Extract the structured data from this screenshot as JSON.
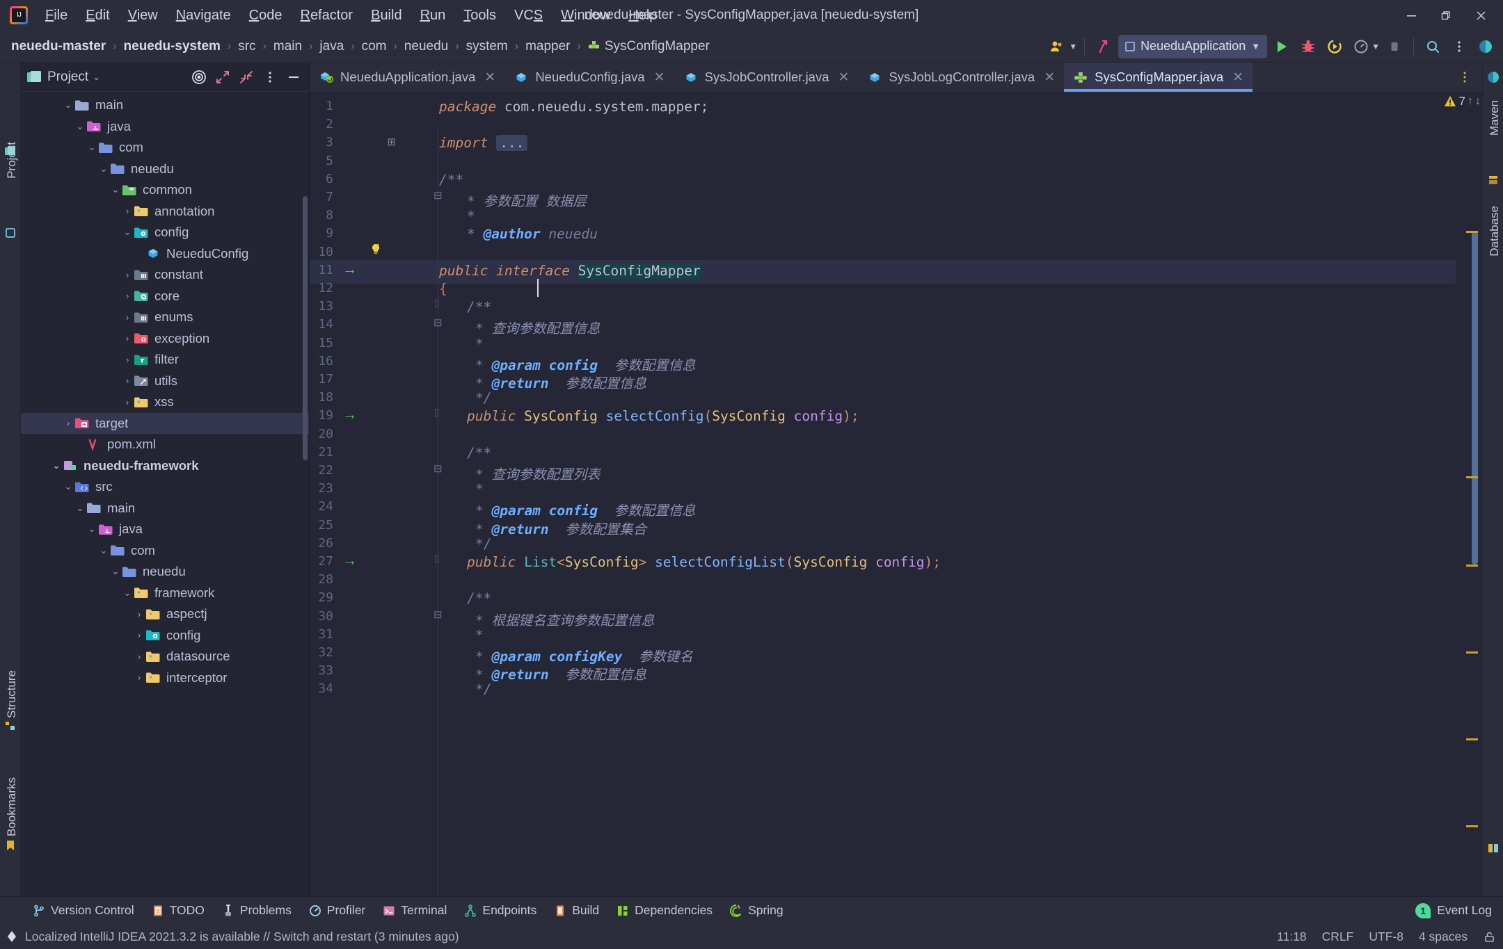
{
  "window": {
    "title": "neuedu-master - SysConfigMapper.java [neuedu-system]",
    "minimize": "–",
    "restore": "❐",
    "close": "✕"
  },
  "menubar": {
    "items": [
      {
        "label": "File",
        "mnemonic": "F"
      },
      {
        "label": "Edit",
        "mnemonic": "E"
      },
      {
        "label": "View",
        "mnemonic": "V"
      },
      {
        "label": "Navigate",
        "mnemonic": "N"
      },
      {
        "label": "Code",
        "mnemonic": "C"
      },
      {
        "label": "Refactor",
        "mnemonic": "R"
      },
      {
        "label": "Build",
        "mnemonic": "B"
      },
      {
        "label": "Run",
        "mnemonic": "R"
      },
      {
        "label": "Tools",
        "mnemonic": "T"
      },
      {
        "label": "VCS",
        "mnemonic": "S"
      },
      {
        "label": "Window",
        "mnemonic": "W"
      },
      {
        "label": "Help",
        "mnemonic": "H"
      }
    ]
  },
  "navbar": {
    "breadcrumbs": [
      {
        "label": "neuedu-master",
        "bold": true
      },
      {
        "label": "neuedu-system",
        "bold": true
      },
      {
        "label": "src",
        "bold": false
      },
      {
        "label": "main",
        "bold": false
      },
      {
        "label": "java",
        "bold": false
      },
      {
        "label": "com",
        "bold": false
      },
      {
        "label": "neuedu",
        "bold": false
      },
      {
        "label": "system",
        "bold": false
      },
      {
        "label": "mapper",
        "bold": false
      },
      {
        "label": "SysConfigMapper",
        "bold": false,
        "icon": "interface-icon"
      }
    ],
    "run_configuration": "NeueduApplication",
    "buttons": [
      "user-avatar-icon",
      "updates-icon",
      "run-icon",
      "debug-icon",
      "run-with-coverage-icon",
      "profiler-icon",
      "stop-icon",
      "search-icon",
      "more-options-icon"
    ]
  },
  "left_strips": {
    "top_tab": "Project",
    "bottom_tabs": [
      "Structure",
      "Bookmarks"
    ]
  },
  "right_strip": {
    "tabs": [
      "Maven",
      "Database"
    ]
  },
  "project_panel": {
    "title": "Project",
    "tree": [
      {
        "label": "main",
        "indent": 3,
        "arrow": "down",
        "icon": "folder-plain",
        "bold": false,
        "selected": false
      },
      {
        "label": "java",
        "indent": 4,
        "arrow": "down",
        "icon": "folder-java",
        "bold": false,
        "selected": false
      },
      {
        "label": "com",
        "indent": 5,
        "arrow": "down",
        "icon": "folder-package",
        "bold": false,
        "selected": false
      },
      {
        "label": "neuedu",
        "indent": 6,
        "arrow": "down",
        "icon": "folder-package",
        "bold": false,
        "selected": false
      },
      {
        "label": "common",
        "indent": 7,
        "arrow": "down",
        "icon": "folder-source",
        "bold": false,
        "selected": false
      },
      {
        "label": "annotation",
        "indent": 8,
        "arrow": "right",
        "icon": "folder-pkg-yellow",
        "bold": false,
        "selected": false
      },
      {
        "label": "config",
        "indent": 8,
        "arrow": "down",
        "icon": "folder-config",
        "bold": false,
        "selected": false
      },
      {
        "label": "NeueduConfig",
        "indent": 9,
        "arrow": "none",
        "icon": "class-icon",
        "bold": false,
        "selected": false
      },
      {
        "label": "constant",
        "indent": 8,
        "arrow": "right",
        "icon": "folder-constant",
        "bold": false,
        "selected": false
      },
      {
        "label": "core",
        "indent": 8,
        "arrow": "right",
        "icon": "folder-core",
        "bold": false,
        "selected": false
      },
      {
        "label": "enums",
        "indent": 8,
        "arrow": "right",
        "icon": "folder-constant",
        "bold": false,
        "selected": false
      },
      {
        "label": "exception",
        "indent": 8,
        "arrow": "right",
        "icon": "folder-exception",
        "bold": false,
        "selected": false
      },
      {
        "label": "filter",
        "indent": 8,
        "arrow": "right",
        "icon": "folder-filter",
        "bold": false,
        "selected": false
      },
      {
        "label": "utils",
        "indent": 8,
        "arrow": "right",
        "icon": "folder-utils",
        "bold": false,
        "selected": false
      },
      {
        "label": "xss",
        "indent": 8,
        "arrow": "right",
        "icon": "folder-pkg-yellow",
        "bold": false,
        "selected": false
      },
      {
        "label": "target",
        "indent": 3,
        "arrow": "right",
        "icon": "folder-target",
        "bold": false,
        "selected": true
      },
      {
        "label": "pom.xml",
        "indent": 4,
        "arrow": "none",
        "icon": "maven-icon",
        "bold": false,
        "selected": false
      },
      {
        "label": "neuedu-framework",
        "indent": 2,
        "arrow": "down",
        "icon": "module-icon",
        "bold": true,
        "selected": false
      },
      {
        "label": "src",
        "indent": 3,
        "arrow": "down",
        "icon": "folder-src",
        "bold": false,
        "selected": false
      },
      {
        "label": "main",
        "indent": 4,
        "arrow": "down",
        "icon": "folder-plain",
        "bold": false,
        "selected": false
      },
      {
        "label": "java",
        "indent": 5,
        "arrow": "down",
        "icon": "folder-java",
        "bold": false,
        "selected": false
      },
      {
        "label": "com",
        "indent": 6,
        "arrow": "down",
        "icon": "folder-package",
        "bold": false,
        "selected": false
      },
      {
        "label": "neuedu",
        "indent": 7,
        "arrow": "down",
        "icon": "folder-package",
        "bold": false,
        "selected": false
      },
      {
        "label": "framework",
        "indent": 8,
        "arrow": "down",
        "icon": "folder-pkg-yellow",
        "bold": false,
        "selected": false
      },
      {
        "label": "aspectj",
        "indent": 9,
        "arrow": "right",
        "icon": "folder-pkg-yellow",
        "bold": false,
        "selected": false
      },
      {
        "label": "config",
        "indent": 9,
        "arrow": "right",
        "icon": "folder-config",
        "bold": false,
        "selected": false
      },
      {
        "label": "datasource",
        "indent": 9,
        "arrow": "right",
        "icon": "folder-pkg-yellow",
        "bold": false,
        "selected": false
      },
      {
        "label": "interceptor",
        "indent": 9,
        "arrow": "right",
        "icon": "folder-pkg-yellow",
        "bold": false,
        "selected": false
      }
    ]
  },
  "editor": {
    "tabs": [
      {
        "label": "NeueduApplication.java",
        "icon": "spring-boot-class-icon",
        "active": false
      },
      {
        "label": "NeueduConfig.java",
        "icon": "class-icon",
        "active": false
      },
      {
        "label": "SysJobController.java",
        "icon": "class-icon",
        "active": false
      },
      {
        "label": "SysJobLogController.java",
        "icon": "class-icon",
        "active": false
      },
      {
        "label": "SysConfigMapper.java",
        "icon": "interface-icon",
        "active": true
      }
    ],
    "warnings_count": "7",
    "lines": [
      {
        "n": 1,
        "indent": 0,
        "tokens": [
          {
            "t": "package ",
            "c": "k"
          },
          {
            "t": "com.neuedu.system.mapper;",
            "c": "pl"
          }
        ]
      },
      {
        "n": 2,
        "indent": 0,
        "tokens": []
      },
      {
        "n": 3,
        "indent": 0,
        "fold": true,
        "tokens": [
          {
            "t": "import ",
            "c": "k"
          },
          {
            "t": "...",
            "c": "fold"
          }
        ]
      },
      {
        "n": 5,
        "indent": 0,
        "tokens": []
      },
      {
        "n": 6,
        "indent": 0,
        "tokens": [
          {
            "t": "/**",
            "c": "cm"
          }
        ]
      },
      {
        "n": 7,
        "indent": 1,
        "tokens": [
          {
            "t": "* ",
            "c": "cm"
          },
          {
            "t": "参数配置 数据层",
            "c": "cmz"
          }
        ]
      },
      {
        "n": 8,
        "indent": 1,
        "tokens": [
          {
            "t": "*",
            "c": "cm"
          }
        ]
      },
      {
        "n": 9,
        "indent": 1,
        "tokens": [
          {
            "t": "* ",
            "c": "cm"
          },
          {
            "t": "@author",
            "c": "tag"
          },
          {
            "t": " neuedu",
            "c": "cm"
          }
        ]
      },
      {
        "n": 10,
        "indent": 1,
        "bulb": true,
        "tokens": []
      },
      {
        "n": 11,
        "indent": 0,
        "highlight": true,
        "gutter_arrow": true,
        "tokens": [
          {
            "t": "public interface ",
            "c": "k"
          },
          {
            "t": "SysConfigMapper",
            "c": "ident-hl"
          }
        ]
      },
      {
        "n": 12,
        "indent": 0,
        "tokens": [
          {
            "t": "{",
            "c": "brace"
          }
        ]
      },
      {
        "n": 13,
        "indent": 1,
        "tokens": [
          {
            "t": "/**",
            "c": "cm"
          }
        ]
      },
      {
        "n": 14,
        "indent": 1,
        "sub": 1,
        "tokens": [
          {
            "t": "* ",
            "c": "cm"
          },
          {
            "t": "查询参数配置信息",
            "c": "cmz"
          }
        ]
      },
      {
        "n": 15,
        "indent": 1,
        "sub": 1,
        "tokens": [
          {
            "t": "*",
            "c": "cm"
          }
        ]
      },
      {
        "n": 16,
        "indent": 1,
        "sub": 1,
        "tokens": [
          {
            "t": "* ",
            "c": "cm"
          },
          {
            "t": "@param config",
            "c": "tag"
          },
          {
            "t": "  参数配置信息",
            "c": "cmz"
          }
        ]
      },
      {
        "n": 17,
        "indent": 1,
        "sub": 1,
        "tokens": [
          {
            "t": "* ",
            "c": "cm"
          },
          {
            "t": "@return",
            "c": "tag"
          },
          {
            "t": "  参数配置信息",
            "c": "cmz"
          }
        ]
      },
      {
        "n": 18,
        "indent": 1,
        "sub": 1,
        "tokens": [
          {
            "t": "*/",
            "c": "cm"
          }
        ]
      },
      {
        "n": 19,
        "indent": 1,
        "gutter_arrow": true,
        "tokens": [
          {
            "t": "public ",
            "c": "k"
          },
          {
            "t": "SysConfig",
            "c": "typ"
          },
          {
            "t": " ",
            "c": "pl"
          },
          {
            "t": "selectConfig",
            "c": "mth"
          },
          {
            "t": "(",
            "c": "pun"
          },
          {
            "t": "SysConfig",
            "c": "typ"
          },
          {
            "t": " ",
            "c": "pl"
          },
          {
            "t": "config",
            "c": "par"
          },
          {
            "t": ");",
            "c": "pun"
          }
        ]
      },
      {
        "n": 20,
        "indent": 0,
        "tokens": []
      },
      {
        "n": 21,
        "indent": 1,
        "tokens": [
          {
            "t": "/**",
            "c": "cm"
          }
        ]
      },
      {
        "n": 22,
        "indent": 1,
        "sub": 1,
        "tokens": [
          {
            "t": "* ",
            "c": "cm"
          },
          {
            "t": "查询参数配置列表",
            "c": "cmz"
          }
        ]
      },
      {
        "n": 23,
        "indent": 1,
        "sub": 1,
        "tokens": [
          {
            "t": "*",
            "c": "cm"
          }
        ]
      },
      {
        "n": 24,
        "indent": 1,
        "sub": 1,
        "tokens": [
          {
            "t": "* ",
            "c": "cm"
          },
          {
            "t": "@param config",
            "c": "tag"
          },
          {
            "t": "  参数配置信息",
            "c": "cmz"
          }
        ]
      },
      {
        "n": 25,
        "indent": 1,
        "sub": 1,
        "tokens": [
          {
            "t": "* ",
            "c": "cm"
          },
          {
            "t": "@return",
            "c": "tag"
          },
          {
            "t": "  参数配置集合",
            "c": "cmz"
          }
        ]
      },
      {
        "n": 26,
        "indent": 1,
        "sub": 1,
        "tokens": [
          {
            "t": "*/",
            "c": "cm"
          }
        ]
      },
      {
        "n": 27,
        "indent": 1,
        "gutter_arrow": true,
        "tokens": [
          {
            "t": "public ",
            "c": "k"
          },
          {
            "t": "List",
            "c": "gen"
          },
          {
            "t": "<",
            "c": "pun"
          },
          {
            "t": "SysConfig",
            "c": "typ"
          },
          {
            "t": "> ",
            "c": "pun"
          },
          {
            "t": "selectConfigList",
            "c": "mth"
          },
          {
            "t": "(",
            "c": "pun"
          },
          {
            "t": "SysConfig",
            "c": "typ"
          },
          {
            "t": " ",
            "c": "pl"
          },
          {
            "t": "config",
            "c": "par"
          },
          {
            "t": ");",
            "c": "pun"
          }
        ]
      },
      {
        "n": 28,
        "indent": 0,
        "tokens": []
      },
      {
        "n": 29,
        "indent": 1,
        "tokens": [
          {
            "t": "/**",
            "c": "cm"
          }
        ]
      },
      {
        "n": 30,
        "indent": 1,
        "sub": 1,
        "tokens": [
          {
            "t": "* ",
            "c": "cm"
          },
          {
            "t": "根据键名查询参数配置信息",
            "c": "cmz"
          }
        ]
      },
      {
        "n": 31,
        "indent": 1,
        "sub": 1,
        "tokens": [
          {
            "t": "*",
            "c": "cm"
          }
        ]
      },
      {
        "n": 32,
        "indent": 1,
        "sub": 1,
        "tokens": [
          {
            "t": "* ",
            "c": "cm"
          },
          {
            "t": "@param configKey",
            "c": "tag"
          },
          {
            "t": "  参数键名",
            "c": "cmz"
          }
        ]
      },
      {
        "n": 33,
        "indent": 1,
        "sub": 1,
        "tokens": [
          {
            "t": "* ",
            "c": "cm"
          },
          {
            "t": "@return",
            "c": "tag"
          },
          {
            "t": "  参数配置信息",
            "c": "cmz"
          }
        ]
      },
      {
        "n": 34,
        "indent": 1,
        "sub": 1,
        "tokens": [
          {
            "t": "*/",
            "c": "cm"
          }
        ]
      }
    ]
  },
  "bottom_tool_window_bar": {
    "items": [
      {
        "label": "Version Control",
        "icon": "branch-icon"
      },
      {
        "label": "TODO",
        "icon": "todo-icon"
      },
      {
        "label": "Problems",
        "icon": "problems-icon"
      },
      {
        "label": "Profiler",
        "icon": "profiler-icon"
      },
      {
        "label": "Terminal",
        "icon": "terminal-icon"
      },
      {
        "label": "Endpoints",
        "icon": "endpoints-icon"
      },
      {
        "label": "Build",
        "icon": "build-icon"
      },
      {
        "label": "Dependencies",
        "icon": "dependencies-icon"
      },
      {
        "label": "Spring",
        "icon": "spring-icon"
      }
    ],
    "event_log": "Event Log",
    "event_log_count": "1"
  },
  "statusbar": {
    "message": "Localized IntelliJ IDEA 2021.3.2 is available // Switch and restart (3 minutes ago)",
    "caret_position": "11:18",
    "line_separator": "CRLF",
    "encoding": "UTF-8",
    "indent": "4 spaces",
    "lock": "unlocked-icon"
  },
  "colors": {
    "accent_blue": "#6c9ce8",
    "background": "#252736",
    "panel": "#2b2d3b",
    "selection": "#353750",
    "green_run": "#59a869",
    "warning_yellow": "#f0c419"
  }
}
